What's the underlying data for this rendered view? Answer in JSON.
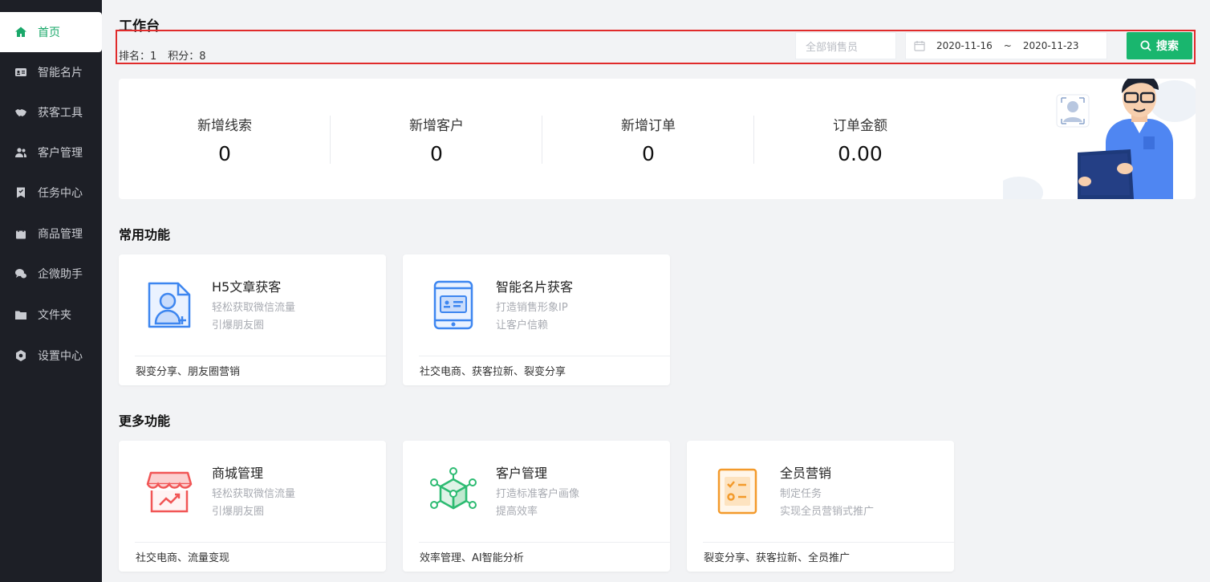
{
  "sidebar": {
    "items": [
      {
        "label": "首页",
        "icon": "home-icon",
        "active": true
      },
      {
        "label": "智能名片",
        "icon": "id-card-icon"
      },
      {
        "label": "获客工具",
        "icon": "handshake-icon"
      },
      {
        "label": "客户管理",
        "icon": "users-icon"
      },
      {
        "label": "任务中心",
        "icon": "bookmark-icon"
      },
      {
        "label": "商品管理",
        "icon": "shopping-bag-icon"
      },
      {
        "label": "企微助手",
        "icon": "chat-bubbles-icon"
      },
      {
        "label": "文件夹",
        "icon": "folder-icon"
      },
      {
        "label": "设置中心",
        "icon": "settings-hexagon-icon"
      }
    ]
  },
  "header": {
    "title": "工作台",
    "rank": "排名：1",
    "points": "积分：8",
    "seller_placeholder": "全部销售员",
    "date_start": "2020-11-16",
    "date_sep": "~",
    "date_end": "2020-11-23",
    "search_label": "搜索"
  },
  "stats": [
    {
      "label": "新增线索",
      "value": "0"
    },
    {
      "label": "新增客户",
      "value": "0"
    },
    {
      "label": "新增订单",
      "value": "0"
    },
    {
      "label": "订单金额",
      "value": "0.00"
    }
  ],
  "common": {
    "title": "常用功能",
    "cards": [
      {
        "title": "H5文章获客",
        "desc1": "轻松获取微信流量",
        "desc2": "引爆朋友圈",
        "footer": "裂变分享、朋友圈营销",
        "icon": "article-user-icon"
      },
      {
        "title": "智能名片获客",
        "desc1": "打造销售形象IP",
        "desc2": "让客户信赖",
        "footer": "社交电商、获客拉新、裂变分享",
        "icon": "tablet-card-icon"
      }
    ]
  },
  "more": {
    "title": "更多功能",
    "cards": [
      {
        "title": "商城管理",
        "desc1": "轻松获取微信流量",
        "desc2": "引爆朋友圈",
        "footer": "社交电商、流量变现",
        "icon": "store-icon"
      },
      {
        "title": "客户管理",
        "desc1": "打造标准客户画像",
        "desc2": "提高效率",
        "footer": "效率管理、AI智能分析",
        "icon": "cube-network-icon"
      },
      {
        "title": "全员营销",
        "desc1": "制定任务",
        "desc2": "实现全员营销式推广",
        "footer": "裂变分享、获客拉新、全员推广",
        "icon": "checklist-icon"
      }
    ]
  },
  "colors": {
    "accent": "#19b66e",
    "sidebar_bg": "#1d1f26",
    "highlight_border": "#e02b2b"
  }
}
